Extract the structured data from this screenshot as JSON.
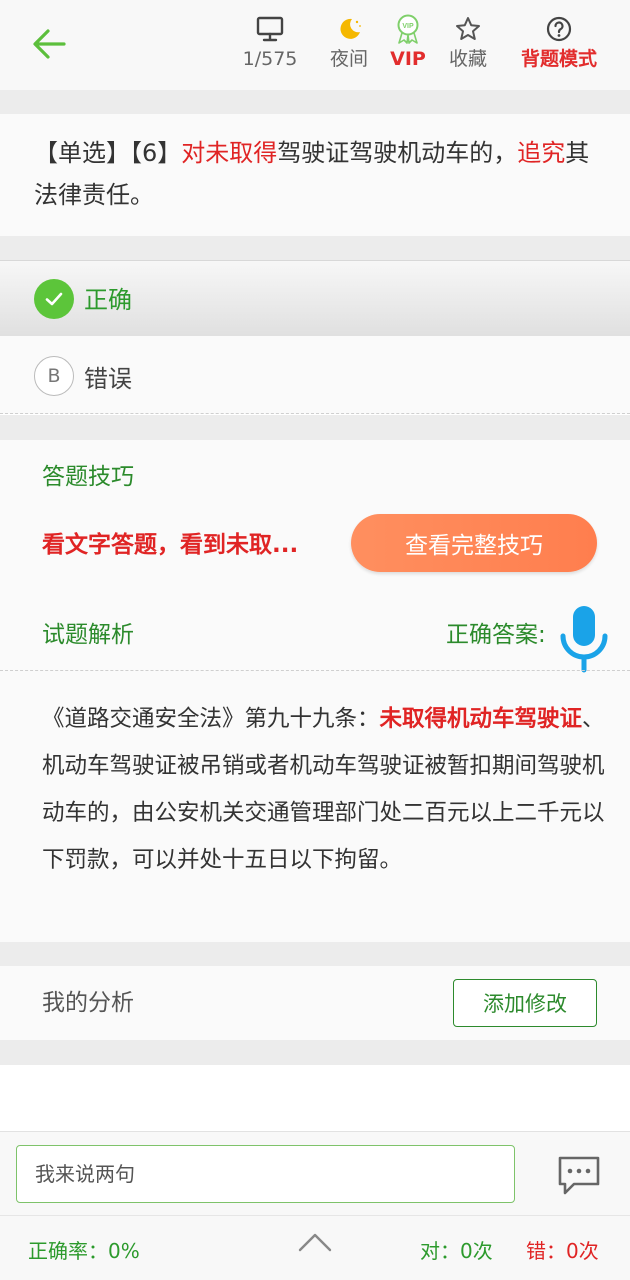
{
  "header": {
    "progress": "1/575",
    "night_label": "夜间",
    "vip_label": "VIP",
    "vip_badge": "VIP",
    "favorite_label": "收藏",
    "mode_label": "背题模式"
  },
  "question": {
    "type": "【单选】",
    "number": "【6】",
    "parts": [
      {
        "text": "对未取得",
        "highlight": true
      },
      {
        "text": "驾驶证驾驶机动车的，",
        "highlight": false
      },
      {
        "text": "追究",
        "highlight": true
      },
      {
        "text": "其法律责任。",
        "highlight": false
      }
    ]
  },
  "options": {
    "correct": {
      "text": "正确",
      "selected": true
    },
    "wrong": {
      "letter": "B",
      "text": "错误"
    }
  },
  "tips": {
    "title": "答题技巧",
    "preview": "看文字答题，看到未取...",
    "button": "查看完整技巧"
  },
  "analysis": {
    "title": "试题解析",
    "answer_label": "正确答案:",
    "parts": [
      {
        "text": "《道路交通安全法》第九十九条：",
        "highlight": false
      },
      {
        "text": "未取得机动车驾驶证",
        "highlight": true
      },
      {
        "text": "、机动车驾驶证被吊销或者机动车驾驶证被暂扣期间驾驶机动车的，由公安机关交通管理部门处二百元以上二千元以下罚款，可以并处十五日以下拘留。",
        "highlight": false
      }
    ]
  },
  "my_analysis": {
    "label": "我的分析",
    "button": "添加修改"
  },
  "comment": {
    "placeholder": "我来说两句"
  },
  "stats": {
    "rate": "正确率：0%",
    "right": "对：0次",
    "wrong": "错：0次"
  },
  "colors": {
    "green": "#2c9a2c",
    "red": "#e02424",
    "orange": "#ff8555",
    "mic_blue": "#1aa3e8"
  }
}
